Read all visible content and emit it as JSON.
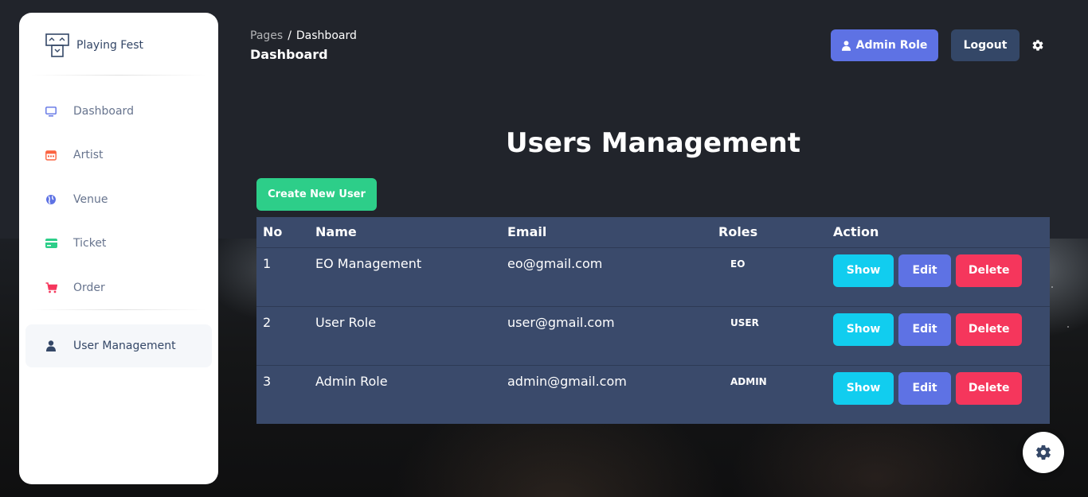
{
  "brand": {
    "name": "Playing Fest",
    "logo_icon": "playing-fest-logo-icon"
  },
  "sidebar": {
    "items": [
      {
        "label": "Dashboard",
        "icon": "monitor-icon",
        "color": "#5e72e4"
      },
      {
        "label": "Artist",
        "icon": "calendar-icon",
        "color": "#fb6340"
      },
      {
        "label": "Venue",
        "icon": "globe-icon",
        "color": "#5e72e4"
      },
      {
        "label": "Ticket",
        "icon": "credit-card-icon",
        "color": "#2dce89"
      },
      {
        "label": "Order",
        "icon": "cart-icon",
        "color": "#f5365c"
      },
      {
        "label": "User Management",
        "icon": "user-icon",
        "color": "#344767",
        "active": true
      }
    ]
  },
  "header": {
    "breadcrumb_parent": "Pages",
    "breadcrumb_separator": "/",
    "breadcrumb_current": "Dashboard",
    "title": "Dashboard",
    "role_button": "Admin Role",
    "logout_button": "Logout",
    "settings_icon": "gear-icon"
  },
  "main": {
    "heading": "Users Management",
    "create_button": "Create New User",
    "table": {
      "headers": {
        "no": "No",
        "name": "Name",
        "email": "Email",
        "roles": "Roles",
        "action": "Action"
      },
      "rows": [
        {
          "no": "1",
          "name": "EO Management",
          "email": "eo@gmail.com",
          "role": "EO"
        },
        {
          "no": "2",
          "name": "User Role",
          "email": "user@gmail.com",
          "role": "USER"
        },
        {
          "no": "3",
          "name": "Admin Role",
          "email": "admin@gmail.com",
          "role": "ADMIN"
        }
      ],
      "actions": {
        "show": "Show",
        "edit": "Edit",
        "delete": "Delete"
      }
    }
  },
  "colors": {
    "primary": "#5e72e4",
    "success": "#2dce89",
    "info": "#11cdef",
    "danger": "#f5365c",
    "dark": "#344767",
    "table_bg": "#3a4a6b"
  }
}
